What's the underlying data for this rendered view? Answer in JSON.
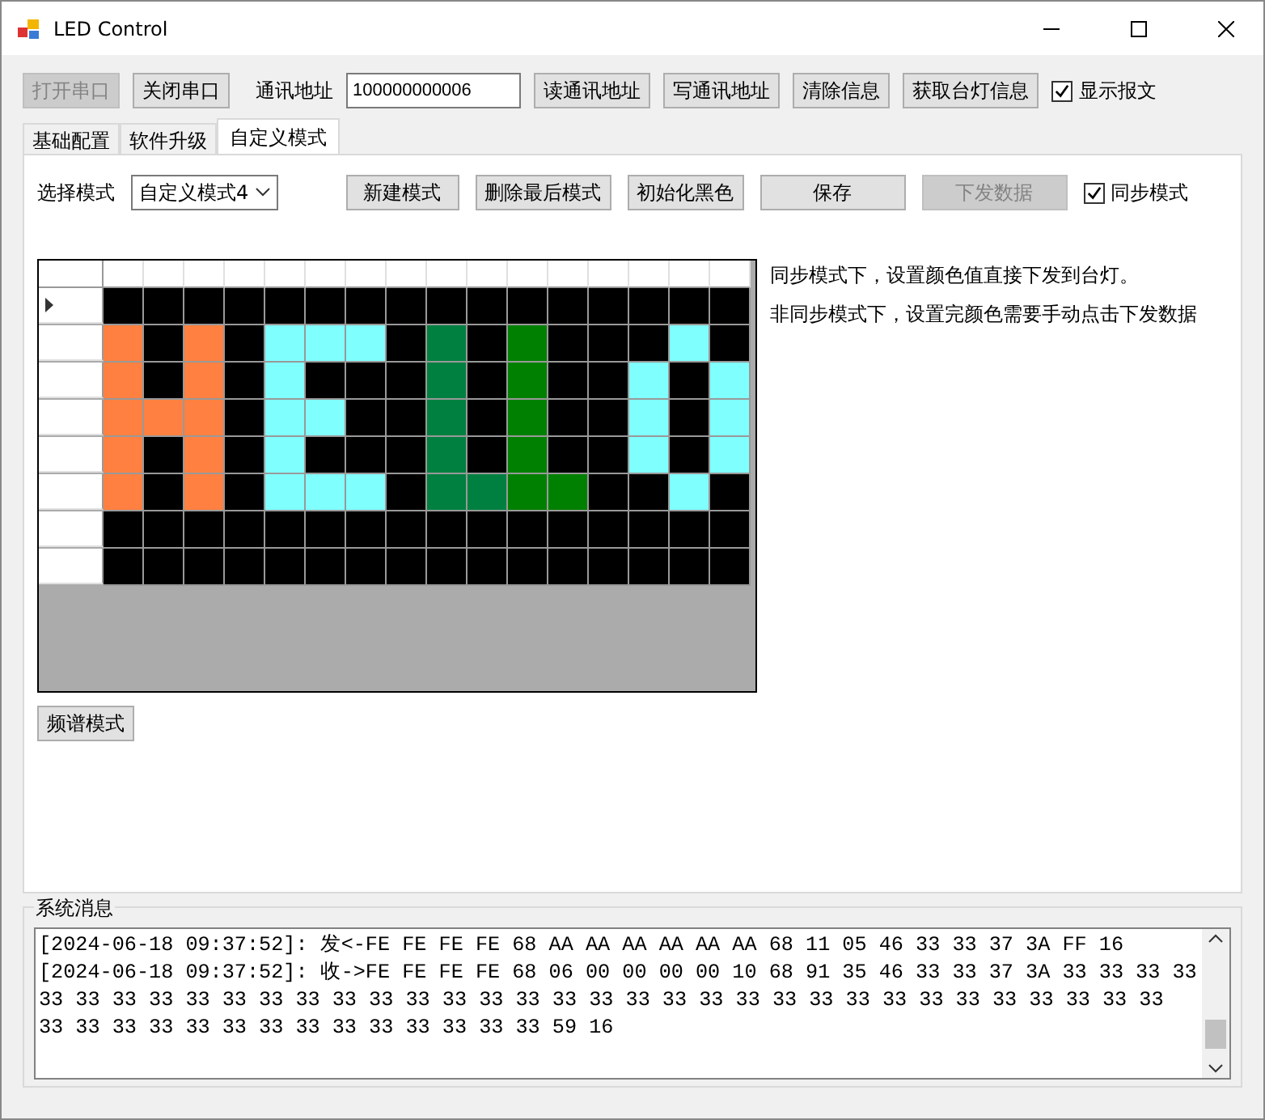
{
  "window": {
    "title": "LED Control"
  },
  "toolbar": {
    "buttons": [
      {
        "label": "打开串口",
        "disabled": true
      },
      {
        "label": "关闭串口",
        "disabled": false
      }
    ],
    "address_label": "通讯地址",
    "address_value": "100000000006",
    "actions": [
      {
        "label": "读通讯地址",
        "disabled": false
      },
      {
        "label": "写通讯地址",
        "disabled": false
      },
      {
        "label": "清除信息",
        "disabled": false
      },
      {
        "label": "获取台灯信息",
        "disabled": false
      }
    ],
    "show_message": {
      "label": "显示报文",
      "checked": true
    }
  },
  "tabs": [
    {
      "label": "基础配置",
      "selected": false
    },
    {
      "label": "软件升级",
      "selected": false
    },
    {
      "label": "自定义模式",
      "selected": true
    }
  ],
  "mode_bar": {
    "select_label": "选择模式",
    "select_value": "自定义模式4",
    "buttons": [
      {
        "label": "新建模式",
        "disabled": false
      },
      {
        "label": "删除最后模式",
        "disabled": false
      },
      {
        "label": "初始化黑色",
        "disabled": false
      },
      {
        "label": "保存",
        "disabled": false
      },
      {
        "label": "下发数据",
        "disabled": true
      }
    ],
    "sync": {
      "label": "同步模式",
      "checked": true
    }
  },
  "grid": {
    "rows": [
      {
        "current": true,
        "cells": [
          {
            "color": "#000000"
          },
          {
            "color": "#000000"
          },
          {
            "color": "#000000"
          },
          {
            "color": "#000000"
          },
          {
            "color": "#000000"
          },
          {
            "color": "#000000"
          },
          {
            "color": "#000000"
          },
          {
            "color": "#000000"
          },
          {
            "color": "#000000"
          },
          {
            "color": "#000000"
          },
          {
            "color": "#000000"
          },
          {
            "color": "#000000"
          },
          {
            "color": "#000000"
          },
          {
            "color": "#000000"
          },
          {
            "color": "#000000"
          },
          {
            "color": "#000000"
          }
        ]
      },
      {
        "current": false,
        "cells": [
          {
            "color": "#ff8040"
          },
          {
            "color": "#000000"
          },
          {
            "color": "#ff8040"
          },
          {
            "color": "#000000"
          },
          {
            "color": "#80ffff"
          },
          {
            "color": "#80ffff"
          },
          {
            "color": "#80ffff"
          },
          {
            "color": "#000000"
          },
          {
            "color": "#008040"
          },
          {
            "color": "#000000"
          },
          {
            "color": "#008000"
          },
          {
            "color": "#000000"
          },
          {
            "color": "#000000"
          },
          {
            "color": "#000000"
          },
          {
            "color": "#80ffff"
          },
          {
            "color": "#000000"
          }
        ]
      },
      {
        "current": false,
        "cells": [
          {
            "color": "#ff8040"
          },
          {
            "color": "#000000"
          },
          {
            "color": "#ff8040"
          },
          {
            "color": "#000000"
          },
          {
            "color": "#80ffff"
          },
          {
            "color": "#000000"
          },
          {
            "color": "#000000"
          },
          {
            "color": "#000000"
          },
          {
            "color": "#008040"
          },
          {
            "color": "#000000"
          },
          {
            "color": "#008000"
          },
          {
            "color": "#000000"
          },
          {
            "color": "#000000"
          },
          {
            "color": "#80ffff"
          },
          {
            "color": "#000000"
          },
          {
            "color": "#80ffff"
          }
        ]
      },
      {
        "current": false,
        "cells": [
          {
            "color": "#ff8040"
          },
          {
            "color": "#ff8040"
          },
          {
            "color": "#ff8040"
          },
          {
            "color": "#000000"
          },
          {
            "color": "#80ffff"
          },
          {
            "color": "#80ffff"
          },
          {
            "color": "#000000"
          },
          {
            "color": "#000000"
          },
          {
            "color": "#008040"
          },
          {
            "color": "#000000"
          },
          {
            "color": "#008000"
          },
          {
            "color": "#000000"
          },
          {
            "color": "#000000"
          },
          {
            "color": "#80ffff"
          },
          {
            "color": "#000000"
          },
          {
            "color": "#80ffff"
          }
        ]
      },
      {
        "current": false,
        "cells": [
          {
            "color": "#ff8040"
          },
          {
            "color": "#000000"
          },
          {
            "color": "#ff8040"
          },
          {
            "color": "#000000"
          },
          {
            "color": "#80ffff"
          },
          {
            "color": "#000000"
          },
          {
            "color": "#000000"
          },
          {
            "color": "#000000"
          },
          {
            "color": "#008040"
          },
          {
            "color": "#000000"
          },
          {
            "color": "#008000"
          },
          {
            "color": "#000000"
          },
          {
            "color": "#000000"
          },
          {
            "color": "#80ffff"
          },
          {
            "color": "#000000"
          },
          {
            "color": "#80ffff"
          }
        ]
      },
      {
        "current": false,
        "cells": [
          {
            "color": "#ff8040"
          },
          {
            "color": "#000000"
          },
          {
            "color": "#ff8040"
          },
          {
            "color": "#000000"
          },
          {
            "color": "#80ffff"
          },
          {
            "color": "#80ffff"
          },
          {
            "color": "#80ffff"
          },
          {
            "color": "#000000"
          },
          {
            "color": "#008040"
          },
          {
            "color": "#008040"
          },
          {
            "color": "#008000"
          },
          {
            "color": "#008000"
          },
          {
            "color": "#000000"
          },
          {
            "color": "#000000"
          },
          {
            "color": "#80ffff"
          },
          {
            "color": "#000000"
          }
        ]
      },
      {
        "current": false,
        "cells": [
          {
            "color": "#000000"
          },
          {
            "color": "#000000"
          },
          {
            "color": "#000000"
          },
          {
            "color": "#000000"
          },
          {
            "color": "#000000"
          },
          {
            "color": "#000000"
          },
          {
            "color": "#000000"
          },
          {
            "color": "#000000"
          },
          {
            "color": "#000000"
          },
          {
            "color": "#000000"
          },
          {
            "color": "#000000"
          },
          {
            "color": "#000000"
          },
          {
            "color": "#000000"
          },
          {
            "color": "#000000"
          },
          {
            "color": "#000000"
          },
          {
            "color": "#000000"
          }
        ]
      },
      {
        "current": false,
        "cells": [
          {
            "color": "#000000"
          },
          {
            "color": "#000000"
          },
          {
            "color": "#000000"
          },
          {
            "color": "#000000"
          },
          {
            "color": "#000000"
          },
          {
            "color": "#000000"
          },
          {
            "color": "#000000"
          },
          {
            "color": "#000000"
          },
          {
            "color": "#000000"
          },
          {
            "color": "#000000"
          },
          {
            "color": "#000000"
          },
          {
            "color": "#000000"
          },
          {
            "color": "#000000"
          },
          {
            "color": "#000000"
          },
          {
            "color": "#000000"
          },
          {
            "color": "#000000"
          }
        ]
      }
    ]
  },
  "notes": [
    "同步模式下，设置颜色值直接下发到台灯。",
    "非同步模式下，设置完颜色需要手动点击下发数据"
  ],
  "spectrum_button": "频谱模式",
  "messages": {
    "title": "系统消息",
    "lines": [
      "[2024-06-18 09:37:52]: 发<-FE FE FE FE 68 AA AA AA AA AA AA 68 11 05 46 33 33 37 3A FF 16",
      "[2024-06-18 09:37:52]: 收->FE FE FE FE 68 06 00 00 00 00 10 68 91 35 46 33 33 37 3A 33 33 33 33 33 33 33 33 33 33 33 33 33 33 33 33 33 33 33 33 33 33 33 33 33 33 33 33 33 33 33 33 33 33 33 33 33 33 33 33 33 33 33 33 33 33 33 33 33 59 16"
    ]
  }
}
